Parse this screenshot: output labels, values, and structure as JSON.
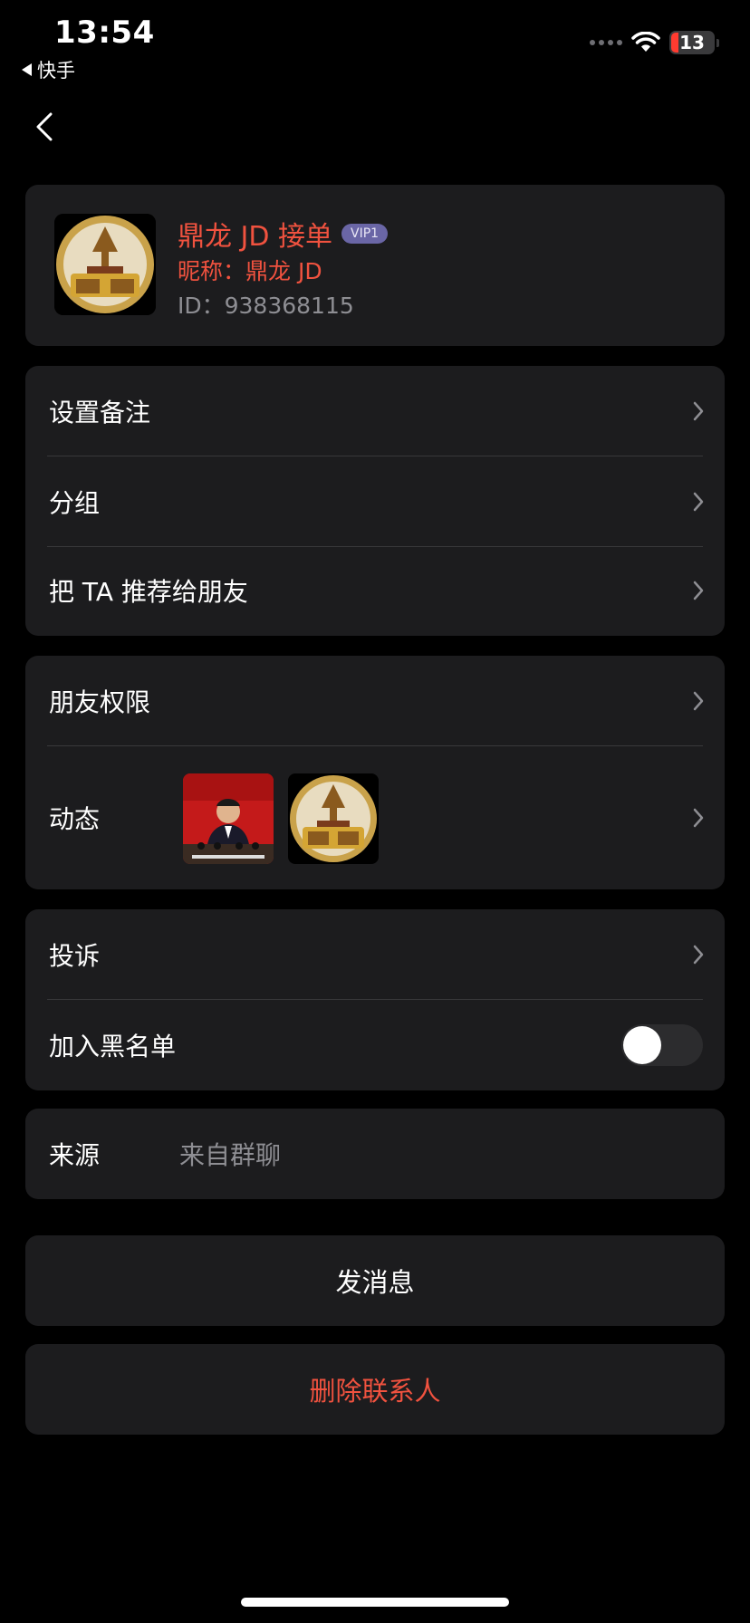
{
  "status_bar": {
    "time": "13:54",
    "back_app": "快手",
    "battery": "13",
    "colors": {
      "battery_low": "#ff3b30"
    }
  },
  "nav": {
    "back_icon": "chevron-left-icon"
  },
  "profile": {
    "name": "鼎龙 JD 接单",
    "vip": "VIP1",
    "nickname": "昵称：鼎龙 JD",
    "id": "ID：938368115",
    "avatar_icon": "gold-emblem-avatar",
    "colors": {
      "name": "#f0523f",
      "vip_bg": "#6a66a6"
    }
  },
  "section1": {
    "items": [
      {
        "label": "设置备注"
      },
      {
        "label": "分组"
      },
      {
        "label": "把 TA 推荐给朋友"
      }
    ]
  },
  "section2": {
    "permissions_label": "朋友权限",
    "moments_label": "动态",
    "moments_thumbs": [
      "speech-photo-thumbnail",
      "gold-emblem-thumbnail"
    ]
  },
  "section3": {
    "report_label": "投诉",
    "blacklist_label": "加入黑名单",
    "blacklist_on": false
  },
  "source": {
    "label": "来源",
    "value": "来自群聊"
  },
  "actions": {
    "send_label": "发消息",
    "delete_label": "删除联系人",
    "colors": {
      "delete": "#f0523f"
    }
  },
  "colors": {
    "background": "#000000",
    "card": "#1c1c1e",
    "divider": "#38383a",
    "secondary_text": "#8e8e93"
  }
}
